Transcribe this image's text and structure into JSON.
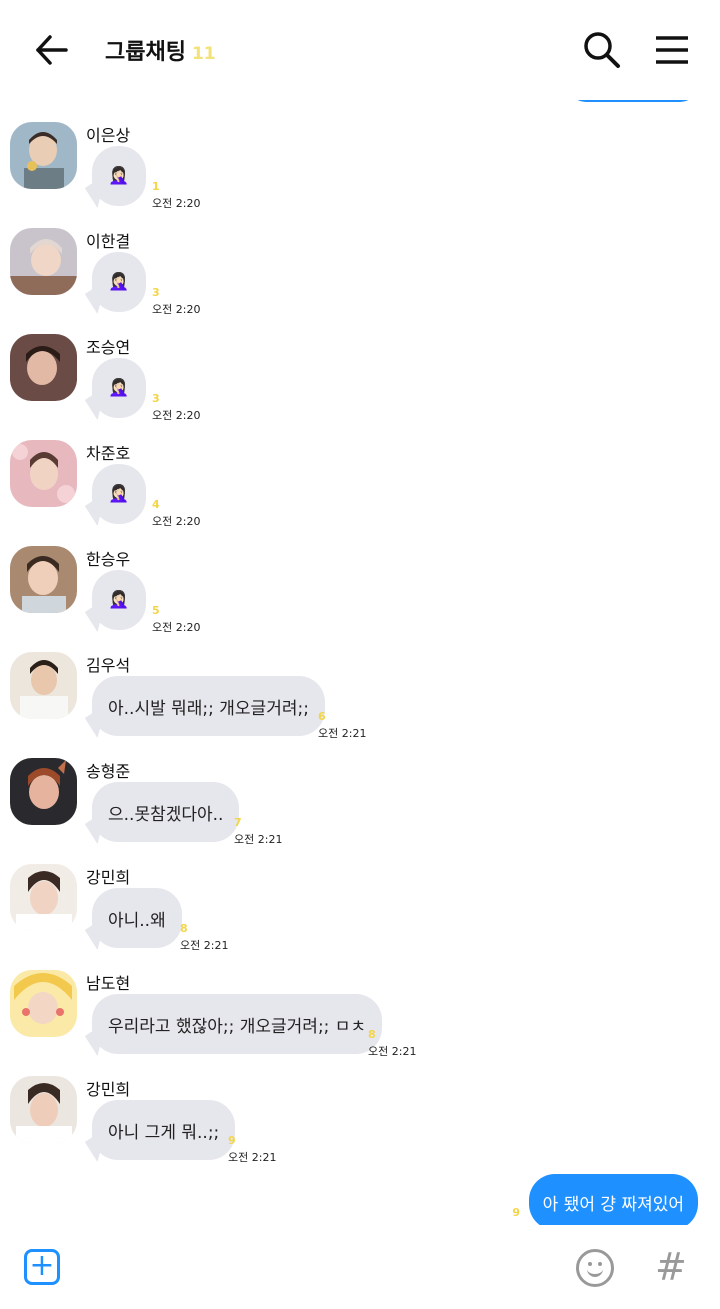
{
  "header": {
    "title": "그룹채팅",
    "member_count": "11"
  },
  "messages": [
    {
      "sender": "이은상",
      "text": "🤦🏻‍♀️",
      "unread": "1",
      "time": "오전 2:20"
    },
    {
      "sender": "이한결",
      "text": "🤦🏻‍♀️",
      "unread": "3",
      "time": "오전 2:20"
    },
    {
      "sender": "조승연",
      "text": "🤦🏻‍♀️",
      "unread": "3",
      "time": "오전 2:20"
    },
    {
      "sender": "차준호",
      "text": "🤦🏻‍♀️",
      "unread": "4",
      "time": "오전 2:20"
    },
    {
      "sender": "한승우",
      "text": "🤦🏻‍♀️",
      "unread": "5",
      "time": "오전 2:20"
    },
    {
      "sender": "김우석",
      "text": "아..시발 뭐래;; 개오글거려;;",
      "unread": "6",
      "time": "오전 2:21"
    },
    {
      "sender": "송형준",
      "text": "으..못참겠다아..",
      "unread": "7",
      "time": "오전 2:21"
    },
    {
      "sender": "강민희",
      "text": "아니..왜",
      "unread": "8",
      "time": "오전 2:21"
    },
    {
      "sender": "남도현",
      "text": "우리라고 했잖아;; 개오글거려;; ㅁㅊ",
      "unread": "8",
      "time": "오전 2:21"
    },
    {
      "sender": "강민희",
      "text": "아니 그게 뭐..;;",
      "unread": "9",
      "time": "오전 2:21"
    }
  ],
  "sent_message": {
    "text": "아 됐어 걍 짜져있어",
    "unread": "9"
  },
  "colors": {
    "accent": "#1e90ff",
    "bubble": "#e6e6ed",
    "unread": "#f3d54a"
  },
  "icons": {
    "back": "arrow-left-icon",
    "search": "search-icon",
    "menu": "hamburger-menu-icon",
    "attach": "plus-square-icon",
    "emoji": "smiley-icon",
    "hashtag": "hashtag-icon"
  }
}
